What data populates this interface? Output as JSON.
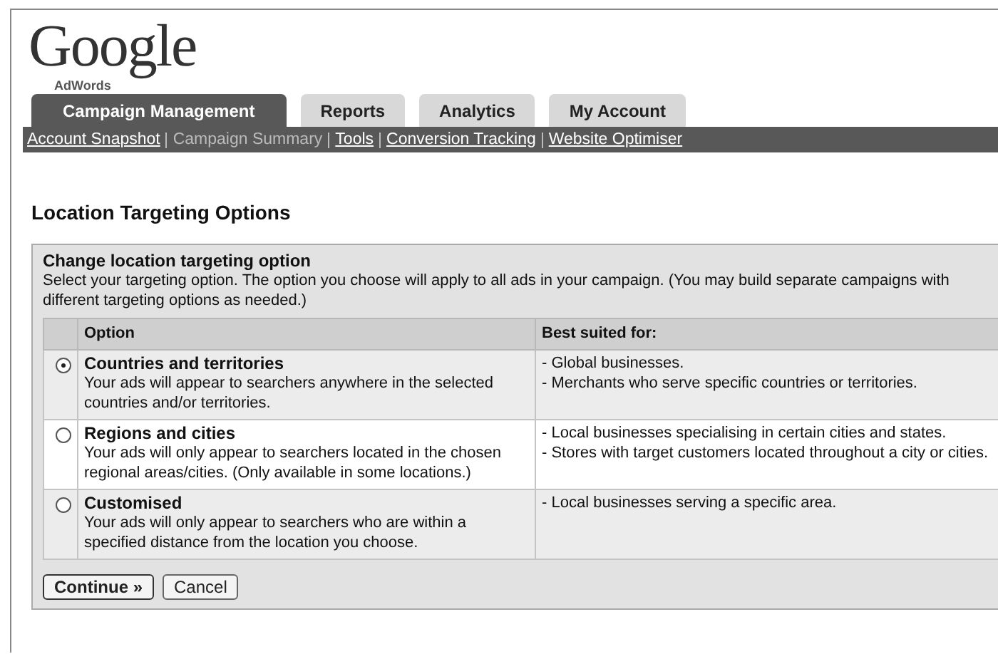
{
  "logo": {
    "wordmark": "Google",
    "product": "AdWords"
  },
  "tabs": [
    {
      "label": "Campaign Management",
      "selected": true
    },
    {
      "label": "Reports",
      "selected": false
    },
    {
      "label": "Analytics",
      "selected": false
    },
    {
      "label": "My Account",
      "selected": false
    }
  ],
  "subnav": [
    {
      "label": "Account Snapshot",
      "selected": false
    },
    {
      "label": "Campaign Summary",
      "selected": true
    },
    {
      "label": "Tools",
      "selected": false
    },
    {
      "label": "Conversion Tracking",
      "selected": false
    },
    {
      "label": "Website Optimiser",
      "selected": false
    }
  ],
  "heading": "Location Targeting Options",
  "panel": {
    "title": "Change location targeting option",
    "description": "Select your targeting option. The option you choose will apply to all ads in your campaign. (You may build separate campaigns with different targeting options as needed.)"
  },
  "table": {
    "columns": [
      "Option",
      "Best suited for:"
    ],
    "rows": [
      {
        "selected": true,
        "title": "Countries and territories",
        "description": "Your ads will appear to searchers anywhere in the selected countries and/or territories.",
        "suited": [
          "- Global businesses.",
          "- Merchants who serve specific countries or territories."
        ]
      },
      {
        "selected": false,
        "title": "Regions and cities",
        "description": "Your ads will only appear to searchers located in the chosen regional areas/cities. (Only available in some locations.)",
        "suited": [
          "- Local businesses specialising in certain cities and states.",
          "- Stores with target customers located throughout a city or cities."
        ]
      },
      {
        "selected": false,
        "title": "Customised",
        "description": "Your ads will only appear to searchers who are within a specified distance from the location you choose.",
        "suited": [
          "- Local businesses serving a specific area."
        ]
      }
    ]
  },
  "buttons": [
    {
      "label": "Continue »",
      "kind": "primary"
    },
    {
      "label": "Cancel",
      "kind": "secondary"
    }
  ]
}
